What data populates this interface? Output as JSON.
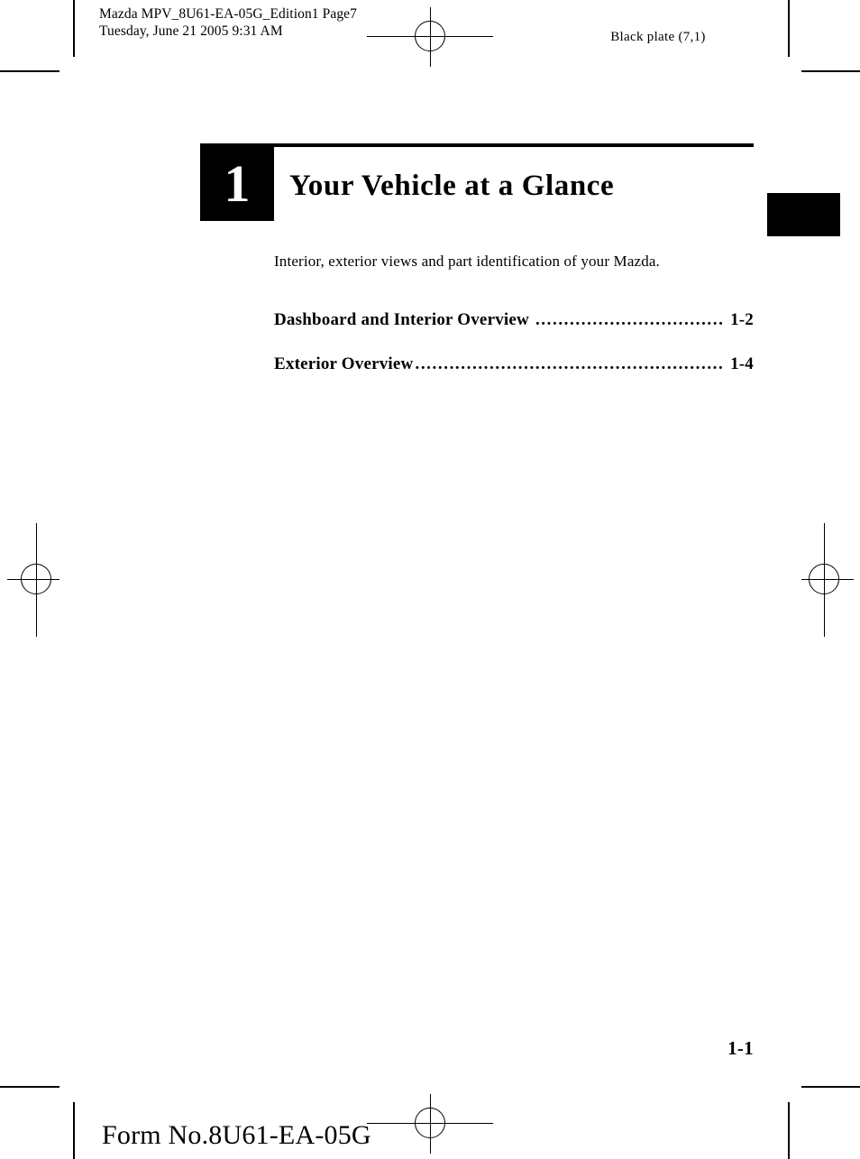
{
  "document": {
    "header": {
      "file_line": "Mazda MPV_8U61-EA-05G_Edition1  Page7",
      "date_line": "Tuesday, June 21 2005 9:31 AM",
      "plate_label": "Black plate (7,1)"
    },
    "chapter": {
      "number": "1",
      "title": "Your Vehicle at a Glance",
      "intro": "Interior, exterior views and part identification of your Mazda."
    },
    "toc": {
      "entries": [
        {
          "label": "Dashboard and Interior Overview",
          "dots": "..............................................",
          "page": "1-2"
        },
        {
          "label": "Exterior Overview",
          "dots": "........................................................................",
          "page": "1-4"
        }
      ]
    },
    "footer": {
      "folio": "1-1",
      "form_number": "Form No.8U61-EA-05G"
    },
    "colors": {
      "ink": "#000000",
      "paper": "#ffffff"
    }
  }
}
